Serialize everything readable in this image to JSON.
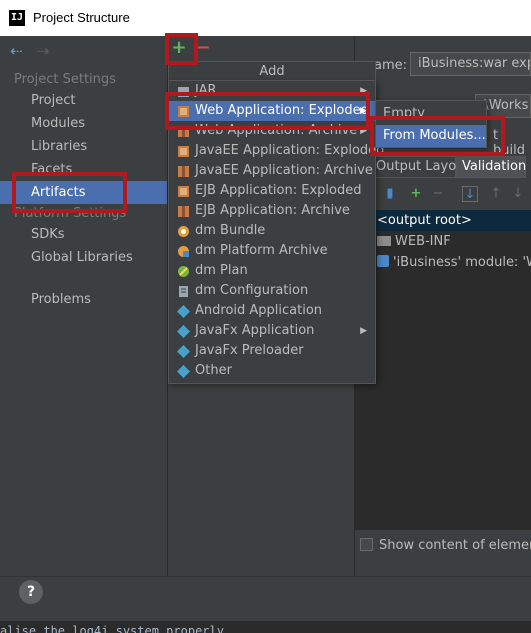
{
  "window": {
    "title": "Project Structure",
    "app_icon_text": "IJ"
  },
  "sidebar": {
    "nav_back_icon": "arrow-left-icon",
    "nav_forward_icon": "arrow-right-icon",
    "project_settings_heading": "Project Settings",
    "project_settings_items": [
      {
        "label": "Project"
      },
      {
        "label": "Modules"
      },
      {
        "label": "Libraries"
      },
      {
        "label": "Facets"
      },
      {
        "label": "Artifacts"
      }
    ],
    "platform_settings_heading": "Platform Settings",
    "platform_settings_items": [
      {
        "label": "SDKs"
      },
      {
        "label": "Global Libraries"
      }
    ],
    "problems_label": "Problems",
    "selected": "Artifacts"
  },
  "toolbar": {
    "add_symbol": "+",
    "remove_symbol": "−"
  },
  "add_menu": {
    "header": "Add",
    "items": [
      {
        "label": "JAR",
        "icon": "jar-icon",
        "submenu": true
      },
      {
        "label": "Web Application: Exploded",
        "icon": "web-exploded-icon",
        "submenu": true
      },
      {
        "label": "Web Application: Archive",
        "icon": "web-archive-icon",
        "submenu": true
      },
      {
        "label": "JavaEE Application: Exploded",
        "icon": "javaee-exploded-icon",
        "submenu": false
      },
      {
        "label": "JavaEE Application: Archive",
        "icon": "javaee-archive-icon",
        "submenu": false
      },
      {
        "label": "EJB Application: Exploded",
        "icon": "ejb-exploded-icon",
        "submenu": false
      },
      {
        "label": "EJB Application: Archive",
        "icon": "ejb-archive-icon",
        "submenu": false
      },
      {
        "label": "dm Bundle",
        "icon": "dm-bundle-icon",
        "submenu": false
      },
      {
        "label": "dm Platform Archive",
        "icon": "dm-platform-icon",
        "submenu": false
      },
      {
        "label": "dm Plan",
        "icon": "dm-plan-icon",
        "submenu": false
      },
      {
        "label": "dm Configuration",
        "icon": "dm-config-icon",
        "submenu": false
      },
      {
        "label": "Android Application",
        "icon": "android-icon",
        "submenu": false
      },
      {
        "label": "JavaFx Application",
        "icon": "javafx-icon",
        "submenu": true
      },
      {
        "label": "JavaFx Preloader",
        "icon": "javafx-preloader-icon",
        "submenu": false
      },
      {
        "label": "Other",
        "icon": "other-icon",
        "submenu": false
      }
    ],
    "highlighted": "Web Application: Exploded"
  },
  "submenu": {
    "items": [
      {
        "label": "Empty"
      },
      {
        "label": "From Modules..."
      }
    ],
    "highlighted": "From Modules..."
  },
  "right_panel": {
    "name_label": "ame:",
    "name_value": "iBusiness:war exploded",
    "output_dir_value": ":\\Works",
    "build_label": "t build",
    "tabs": [
      {
        "label": "Output Layout"
      },
      {
        "label": "Validation"
      }
    ],
    "tree": [
      {
        "label": "<output root>",
        "selected": true
      },
      {
        "label": "WEB-INF",
        "selected": false
      },
      {
        "label": "'iBusiness' module: 'Web'",
        "selected": false
      }
    ],
    "show_content_label": "Show content of elements"
  },
  "bottom": {
    "help_label": "?"
  },
  "console": {
    "text": "alise the log4j system properly."
  },
  "colors": {
    "selection": "#4b6eaf",
    "annotation": "#b0191e",
    "add_green": "#5fb760",
    "remove_red": "#c75450"
  }
}
